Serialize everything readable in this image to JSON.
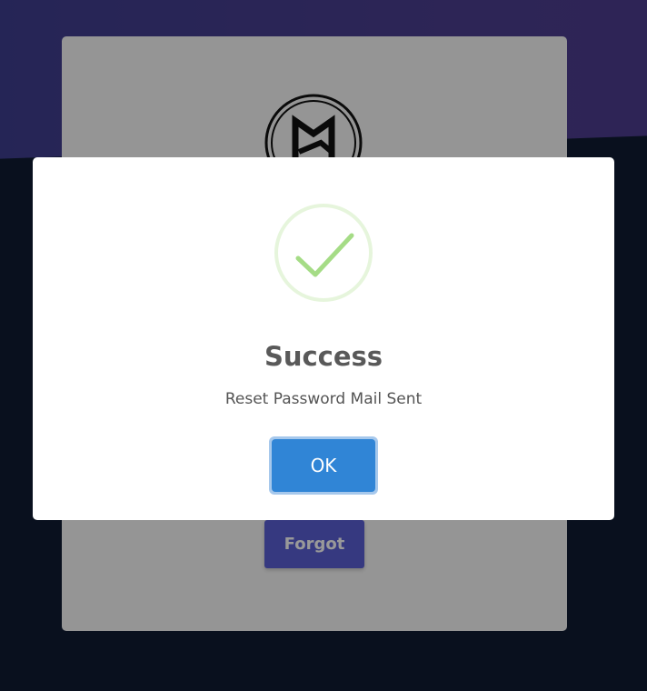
{
  "login_card": {
    "logo_icon": "m-monogram-logo-icon",
    "forgot_label": "Forgot"
  },
  "dialog": {
    "icon": "success-check-icon",
    "title": "Success",
    "message": "Reset Password Mail Sent",
    "ok_label": "OK"
  },
  "colors": {
    "accent": "#3085d6",
    "success": "#a5dc86",
    "forgot_button": "#5a5fd6",
    "header_gradient": "#4a3f8f",
    "background": "#0f1b32"
  }
}
